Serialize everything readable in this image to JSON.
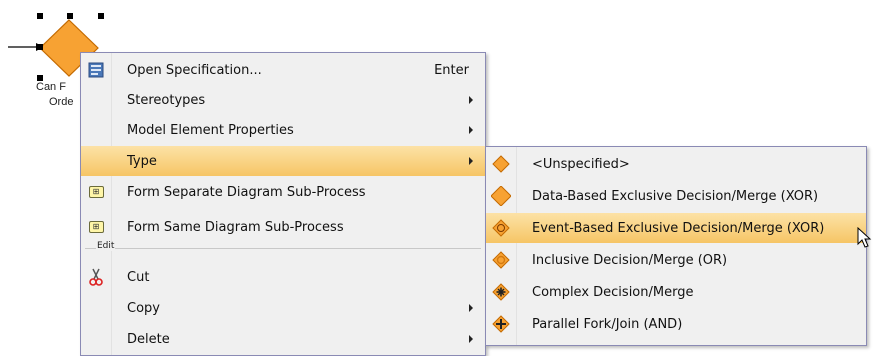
{
  "shape": {
    "label_lines": [
      "Can F",
      "Orde"
    ]
  },
  "context_menu": {
    "items": [
      {
        "label": "Open Specification...",
        "accel": "Enter",
        "icon": "specification-icon"
      },
      {
        "label": "Stereotypes",
        "submenu": true
      },
      {
        "label": "Model Element Properties",
        "submenu": true
      },
      {
        "label": "Type",
        "submenu": true,
        "highlighted": true
      },
      {
        "label": "Form Separate Diagram Sub-Process",
        "icon": "sub-process-icon"
      },
      {
        "label": "Form Same Diagram Sub-Process",
        "icon": "sub-process-icon"
      }
    ],
    "section_label": "Edit",
    "edit_items": [
      {
        "label": "Cut",
        "icon": "scissors-icon"
      },
      {
        "label": "Copy",
        "submenu": true
      },
      {
        "label": "Delete",
        "submenu": true
      }
    ]
  },
  "type_submenu": {
    "items": [
      {
        "label": "<Unspecified>",
        "icon": "gateway-unspecified-icon"
      },
      {
        "label": "Data-Based Exclusive Decision/Merge (XOR)",
        "icon": "gateway-data-xor-icon"
      },
      {
        "label": "Event-Based Exclusive Decision/Merge (XOR)",
        "icon": "gateway-event-xor-icon",
        "highlighted": true
      },
      {
        "label": "Inclusive Decision/Merge (OR)",
        "icon": "gateway-inclusive-icon"
      },
      {
        "label": "Complex Decision/Merge",
        "icon": "gateway-complex-icon"
      },
      {
        "label": "Parallel Fork/Join (AND)",
        "icon": "gateway-parallel-icon"
      }
    ]
  },
  "colors": {
    "gateway_fill": "#f7a233",
    "gateway_stroke": "#c46a00",
    "highlight": "#f6c565"
  }
}
